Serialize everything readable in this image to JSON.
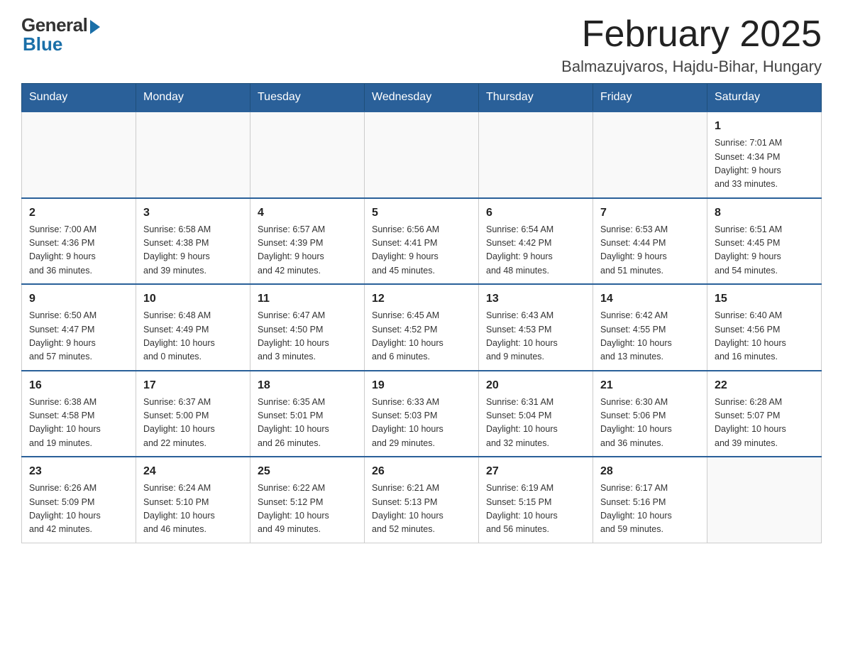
{
  "header": {
    "logo_general": "General",
    "logo_blue": "Blue",
    "month_title": "February 2025",
    "location": "Balmazujvaros, Hajdu-Bihar, Hungary"
  },
  "weekdays": [
    "Sunday",
    "Monday",
    "Tuesday",
    "Wednesday",
    "Thursday",
    "Friday",
    "Saturday"
  ],
  "weeks": [
    [
      {
        "day": "",
        "info": ""
      },
      {
        "day": "",
        "info": ""
      },
      {
        "day": "",
        "info": ""
      },
      {
        "day": "",
        "info": ""
      },
      {
        "day": "",
        "info": ""
      },
      {
        "day": "",
        "info": ""
      },
      {
        "day": "1",
        "info": "Sunrise: 7:01 AM\nSunset: 4:34 PM\nDaylight: 9 hours\nand 33 minutes."
      }
    ],
    [
      {
        "day": "2",
        "info": "Sunrise: 7:00 AM\nSunset: 4:36 PM\nDaylight: 9 hours\nand 36 minutes."
      },
      {
        "day": "3",
        "info": "Sunrise: 6:58 AM\nSunset: 4:38 PM\nDaylight: 9 hours\nand 39 minutes."
      },
      {
        "day": "4",
        "info": "Sunrise: 6:57 AM\nSunset: 4:39 PM\nDaylight: 9 hours\nand 42 minutes."
      },
      {
        "day": "5",
        "info": "Sunrise: 6:56 AM\nSunset: 4:41 PM\nDaylight: 9 hours\nand 45 minutes."
      },
      {
        "day": "6",
        "info": "Sunrise: 6:54 AM\nSunset: 4:42 PM\nDaylight: 9 hours\nand 48 minutes."
      },
      {
        "day": "7",
        "info": "Sunrise: 6:53 AM\nSunset: 4:44 PM\nDaylight: 9 hours\nand 51 minutes."
      },
      {
        "day": "8",
        "info": "Sunrise: 6:51 AM\nSunset: 4:45 PM\nDaylight: 9 hours\nand 54 minutes."
      }
    ],
    [
      {
        "day": "9",
        "info": "Sunrise: 6:50 AM\nSunset: 4:47 PM\nDaylight: 9 hours\nand 57 minutes."
      },
      {
        "day": "10",
        "info": "Sunrise: 6:48 AM\nSunset: 4:49 PM\nDaylight: 10 hours\nand 0 minutes."
      },
      {
        "day": "11",
        "info": "Sunrise: 6:47 AM\nSunset: 4:50 PM\nDaylight: 10 hours\nand 3 minutes."
      },
      {
        "day": "12",
        "info": "Sunrise: 6:45 AM\nSunset: 4:52 PM\nDaylight: 10 hours\nand 6 minutes."
      },
      {
        "day": "13",
        "info": "Sunrise: 6:43 AM\nSunset: 4:53 PM\nDaylight: 10 hours\nand 9 minutes."
      },
      {
        "day": "14",
        "info": "Sunrise: 6:42 AM\nSunset: 4:55 PM\nDaylight: 10 hours\nand 13 minutes."
      },
      {
        "day": "15",
        "info": "Sunrise: 6:40 AM\nSunset: 4:56 PM\nDaylight: 10 hours\nand 16 minutes."
      }
    ],
    [
      {
        "day": "16",
        "info": "Sunrise: 6:38 AM\nSunset: 4:58 PM\nDaylight: 10 hours\nand 19 minutes."
      },
      {
        "day": "17",
        "info": "Sunrise: 6:37 AM\nSunset: 5:00 PM\nDaylight: 10 hours\nand 22 minutes."
      },
      {
        "day": "18",
        "info": "Sunrise: 6:35 AM\nSunset: 5:01 PM\nDaylight: 10 hours\nand 26 minutes."
      },
      {
        "day": "19",
        "info": "Sunrise: 6:33 AM\nSunset: 5:03 PM\nDaylight: 10 hours\nand 29 minutes."
      },
      {
        "day": "20",
        "info": "Sunrise: 6:31 AM\nSunset: 5:04 PM\nDaylight: 10 hours\nand 32 minutes."
      },
      {
        "day": "21",
        "info": "Sunrise: 6:30 AM\nSunset: 5:06 PM\nDaylight: 10 hours\nand 36 minutes."
      },
      {
        "day": "22",
        "info": "Sunrise: 6:28 AM\nSunset: 5:07 PM\nDaylight: 10 hours\nand 39 minutes."
      }
    ],
    [
      {
        "day": "23",
        "info": "Sunrise: 6:26 AM\nSunset: 5:09 PM\nDaylight: 10 hours\nand 42 minutes."
      },
      {
        "day": "24",
        "info": "Sunrise: 6:24 AM\nSunset: 5:10 PM\nDaylight: 10 hours\nand 46 minutes."
      },
      {
        "day": "25",
        "info": "Sunrise: 6:22 AM\nSunset: 5:12 PM\nDaylight: 10 hours\nand 49 minutes."
      },
      {
        "day": "26",
        "info": "Sunrise: 6:21 AM\nSunset: 5:13 PM\nDaylight: 10 hours\nand 52 minutes."
      },
      {
        "day": "27",
        "info": "Sunrise: 6:19 AM\nSunset: 5:15 PM\nDaylight: 10 hours\nand 56 minutes."
      },
      {
        "day": "28",
        "info": "Sunrise: 6:17 AM\nSunset: 5:16 PM\nDaylight: 10 hours\nand 59 minutes."
      },
      {
        "day": "",
        "info": ""
      }
    ]
  ]
}
